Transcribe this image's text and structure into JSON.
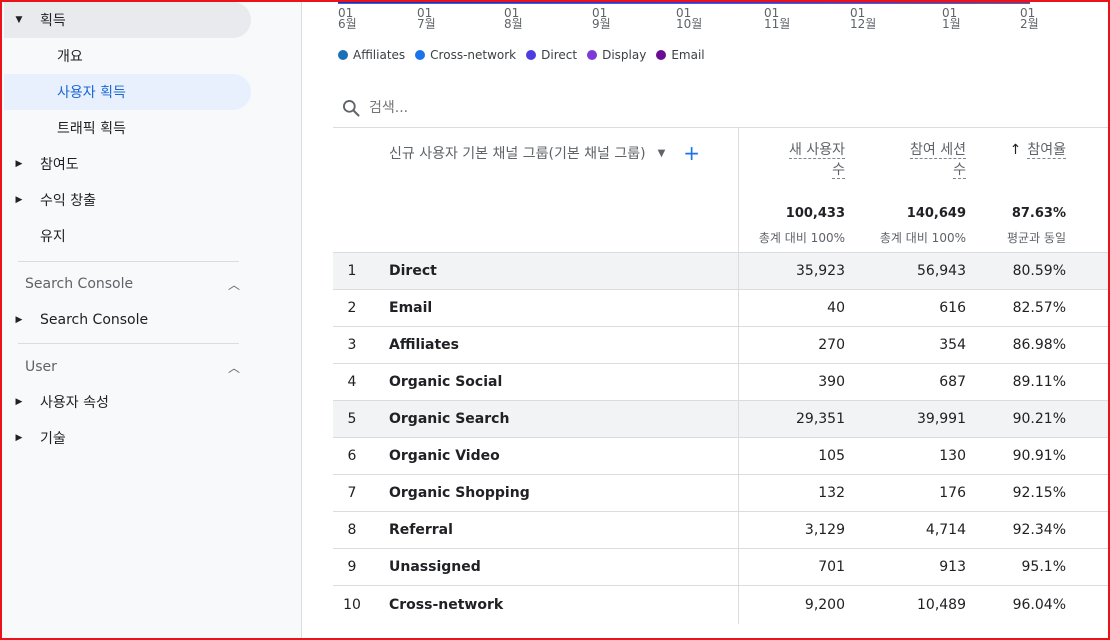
{
  "sidebar": {
    "top_item": {
      "label": "획득",
      "caret": "▼"
    },
    "sub_items": [
      {
        "label": "개요"
      },
      {
        "label": "사용자 획득"
      },
      {
        "label": "트래픽 획득"
      }
    ],
    "main_items": [
      {
        "label": "참여도"
      },
      {
        "label": "수익 창출"
      },
      {
        "label": "유지"
      }
    ],
    "sections": [
      {
        "title": "Search Console",
        "items": [
          {
            "label": "Search Console"
          }
        ]
      },
      {
        "title": "User",
        "items": [
          {
            "label": "사용자 속성"
          },
          {
            "label": "기술"
          }
        ]
      }
    ]
  },
  "chart": {
    "x_ticks": [
      {
        "day": "01",
        "month": "6월"
      },
      {
        "day": "01",
        "month": "7월"
      },
      {
        "day": "01",
        "month": "8월"
      },
      {
        "day": "01",
        "month": "9월"
      },
      {
        "day": "01",
        "month": "10월"
      },
      {
        "day": "01",
        "month": "11월"
      },
      {
        "day": "01",
        "month": "12월"
      },
      {
        "day": "01",
        "month": "1월"
      },
      {
        "day": "01",
        "month": "2월"
      }
    ],
    "legend": [
      {
        "name": "Affiliates",
        "color": "#1a6fb5"
      },
      {
        "name": "Cross-network",
        "color": "#1a73e8"
      },
      {
        "name": "Direct",
        "color": "#4c3de0"
      },
      {
        "name": "Display",
        "color": "#7c3ad8"
      },
      {
        "name": "Email",
        "color": "#6a0d91"
      }
    ]
  },
  "search": {
    "placeholder": "검색..."
  },
  "table": {
    "dimension_header": "신규 사용자 기본 채널 그룹(기본 채널 그룹)",
    "columns": [
      {
        "line1": "새 사용자",
        "line2": "수",
        "total": "100,433",
        "sub": "총계 대비 100%"
      },
      {
        "line1": "참여 세션",
        "line2": "수",
        "total": "140,649",
        "sub": "총계 대비 100%"
      },
      {
        "line1": "참여율",
        "line2": "",
        "total": "87.63%",
        "sub": "평균과 동일",
        "sort_arrow": "↑"
      }
    ],
    "rows": [
      {
        "idx": "1",
        "name": "Direct",
        "v1": "35,923",
        "v2": "56,943",
        "v3": "80.59%"
      },
      {
        "idx": "2",
        "name": "Email",
        "v1": "40",
        "v2": "616",
        "v3": "82.57%"
      },
      {
        "idx": "3",
        "name": "Affiliates",
        "v1": "270",
        "v2": "354",
        "v3": "86.98%"
      },
      {
        "idx": "4",
        "name": "Organic Social",
        "v1": "390",
        "v2": "687",
        "v3": "89.11%"
      },
      {
        "idx": "5",
        "name": "Organic Search",
        "v1": "29,351",
        "v2": "39,991",
        "v3": "90.21%"
      },
      {
        "idx": "6",
        "name": "Organic Video",
        "v1": "105",
        "v2": "130",
        "v3": "90.91%"
      },
      {
        "idx": "7",
        "name": "Organic Shopping",
        "v1": "132",
        "v2": "176",
        "v3": "92.15%"
      },
      {
        "idx": "8",
        "name": "Referral",
        "v1": "3,129",
        "v2": "4,714",
        "v3": "92.34%"
      },
      {
        "idx": "9",
        "name": "Unassigned",
        "v1": "701",
        "v2": "913",
        "v3": "95.1%"
      },
      {
        "idx": "10",
        "name": "Cross-network",
        "v1": "9,200",
        "v2": "10,489",
        "v3": "96.04%"
      }
    ]
  }
}
